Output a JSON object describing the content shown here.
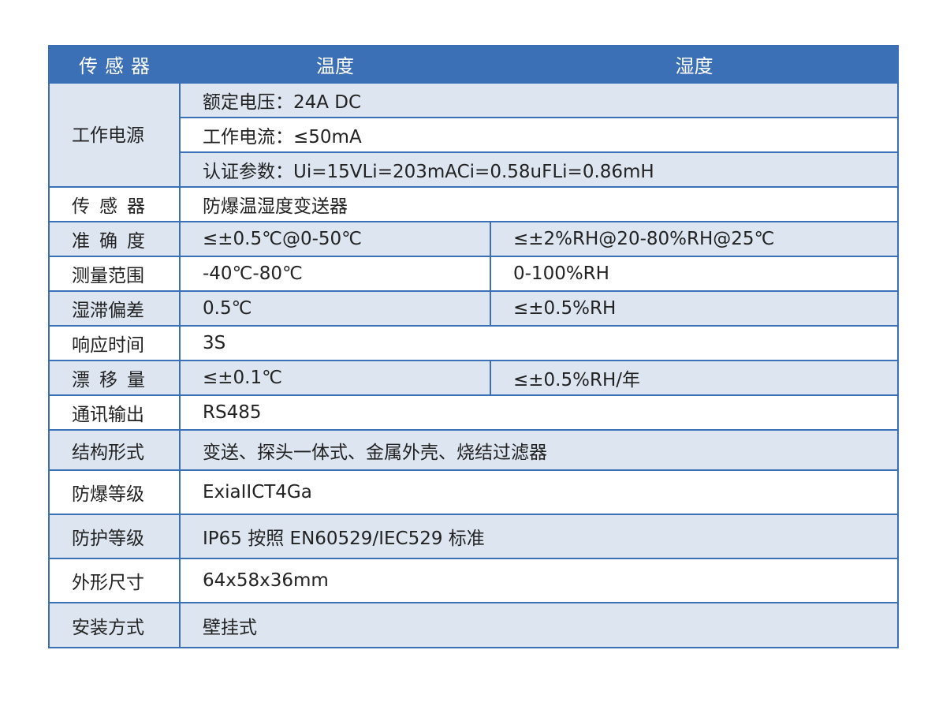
{
  "header": {
    "col1": "传感器",
    "col2": "温度",
    "col3": "湿度"
  },
  "power": {
    "label": "工作电源",
    "rated_voltage_label": "额定电压：",
    "rated_voltage_value": "24A DC",
    "working_current_label": "工作电流：",
    "working_current_value": "≤50mA",
    "certification_label": "认证参数：",
    "certification_value": "Ui=15VLi=203mACi=0.58uFLi=0.86mH"
  },
  "rows": {
    "sensor": {
      "label": "传感器",
      "value": "防爆温湿度变送器"
    },
    "accuracy": {
      "label": "准确度",
      "temperature": "≤±0.5℃@0-50℃",
      "humidity": "≤±2%RH@20-80%RH@25℃"
    },
    "range": {
      "label": "测量范围",
      "temperature": "-40℃-80℃",
      "humidity": "0-100%RH"
    },
    "hysteresis": {
      "label": "湿滞偏差",
      "temperature": "0.5℃",
      "humidity": "≤±0.5%RH"
    },
    "response": {
      "label": "响应时间",
      "value": "3S"
    },
    "drift": {
      "label": "漂移量",
      "temperature": "≤±0.1℃",
      "humidity": "≤±0.5%RH/年"
    },
    "output": {
      "label": "通讯输出",
      "value": "RS485"
    },
    "structure": {
      "label": "结构形式",
      "value": "变送、探头一体式、金属外壳、烧结过滤器"
    },
    "explosion": {
      "label": "防爆等级",
      "value": "ExiaIICT4Ga"
    },
    "protection": {
      "label": "防护等级",
      "value": "IP65 按照 EN60529/IEC529 标准"
    },
    "dimensions": {
      "label": "外形尺寸",
      "value": "64x58x36mm"
    },
    "mounting": {
      "label": "安装方式",
      "value": "壁挂式"
    }
  },
  "colors": {
    "header_bg": "#3b6fb6",
    "shade_bg": "#dde5f1",
    "border": "#3b6fb6"
  }
}
